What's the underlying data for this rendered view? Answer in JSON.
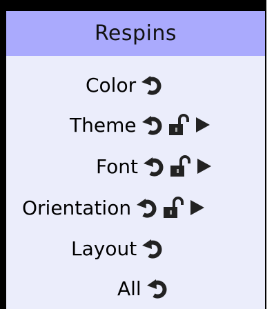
{
  "panel": {
    "title": "Respins",
    "rows": [
      {
        "label": "Color",
        "icons": [
          "respin-icon"
        ]
      },
      {
        "label": "Theme",
        "icons": [
          "respin-icon",
          "unlock-icon",
          "play-arrow-icon"
        ]
      },
      {
        "label": "Font",
        "icons": [
          "respin-icon",
          "unlock-icon",
          "play-arrow-icon"
        ]
      },
      {
        "label": "Orientation",
        "icons": [
          "respin-icon",
          "unlock-icon",
          "play-arrow-icon"
        ]
      },
      {
        "label": "Layout",
        "icons": [
          "respin-icon"
        ]
      },
      {
        "label": "All",
        "icons": [
          "respin-icon"
        ]
      }
    ]
  }
}
